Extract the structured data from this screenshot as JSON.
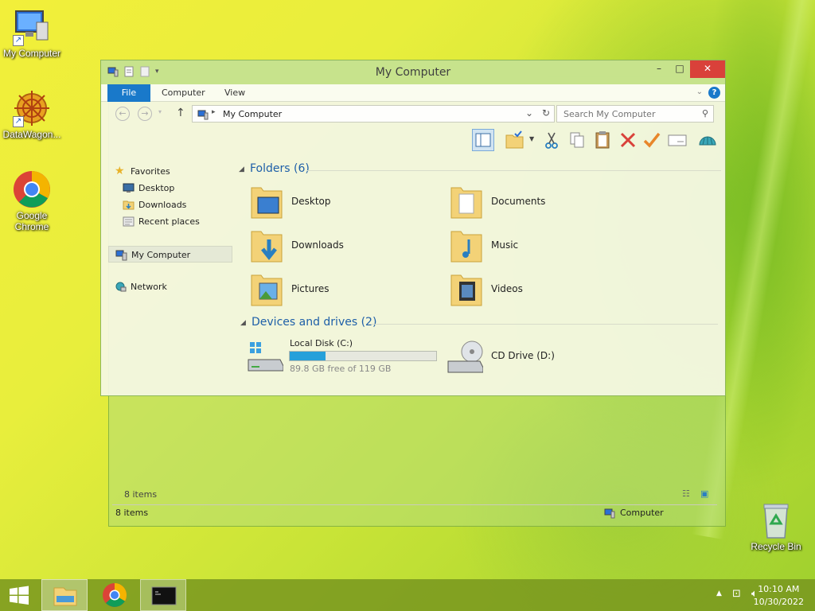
{
  "desktop": {
    "icons": [
      {
        "label": "My Computer"
      },
      {
        "label": "DataWagon..."
      },
      {
        "label": "Google Chrome"
      },
      {
        "label": "Recycle Bin"
      }
    ]
  },
  "window": {
    "title": "My Computer",
    "ribbon_tabs": [
      "File",
      "Computer",
      "View"
    ],
    "address": "My Computer",
    "search_placeholder": "Search My Computer",
    "nav": {
      "favorites_label": "Favorites",
      "favorites_items": [
        "Desktop",
        "Downloads",
        "Recent places"
      ],
      "my_computer_label": "My Computer",
      "network_label": "Network"
    },
    "groups": {
      "folders_heading": "Folders (6)",
      "folders": [
        "Desktop",
        "Documents",
        "Downloads",
        "Music",
        "Pictures",
        "Videos"
      ],
      "devices_heading": "Devices and drives (2)",
      "local_disk": {
        "label": "Local Disk (C:)",
        "free_text": "89.8 GB free of 119 GB",
        "used_fraction": 0.245
      },
      "cd_drive_label": "CD Drive (D:)"
    },
    "status_inner": "8 items",
    "status_left": "8 items",
    "status_right": "Computer"
  },
  "taskbar": {
    "time": "10:10 AM",
    "date": "10/30/2022"
  },
  "colors": {
    "accent": "#1979ca",
    "close": "#d9413a",
    "disk_bar": "#26a0da"
  }
}
